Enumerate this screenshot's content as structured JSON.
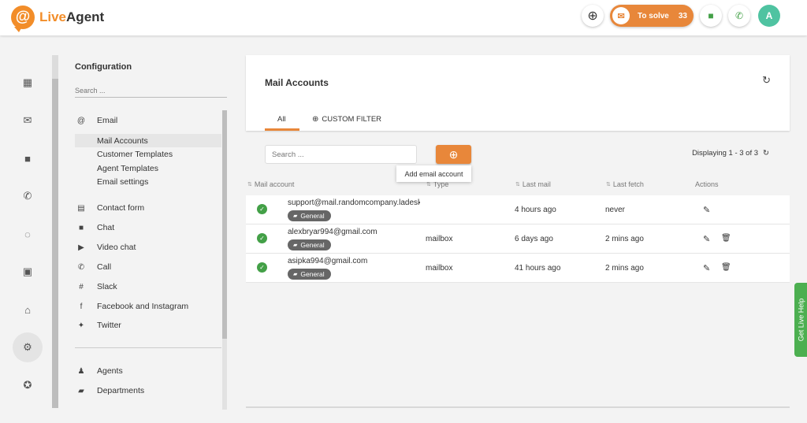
{
  "app": {
    "logo_live": "Live",
    "logo_agent": "Agent",
    "logo_mark": "@"
  },
  "topbar": {
    "solve_label": "To solve",
    "solve_count": "33",
    "avatar_initial": "A",
    "accent_color": "#e8873a"
  },
  "config": {
    "title": "Configuration",
    "search_placeholder": "Search ...",
    "email_group": "Email",
    "email_items": [
      "Mail Accounts",
      "Customer Templates",
      "Agent Templates",
      "Email settings"
    ],
    "channels": [
      "Contact form",
      "Chat",
      "Video chat",
      "Call",
      "Slack",
      "Facebook and Instagram",
      "Twitter"
    ],
    "people": [
      "Agents",
      "Departments"
    ]
  },
  "main": {
    "title": "Mail Accounts",
    "tabs": [
      "All",
      "CUSTOM FILTER"
    ],
    "search_placeholder": "Search ...",
    "add_tooltip": "Add email account",
    "displaying": "Displaying 1 - 3 of 3",
    "columns": [
      "Mail account",
      "Type",
      "Last mail",
      "Last fetch",
      "Actions"
    ],
    "rows": [
      {
        "email": "support@mail.randomcompany.ladesk.com",
        "badge": "General",
        "type": "",
        "last_mail": "4 hours ago",
        "last_fetch": "never"
      },
      {
        "email": "alexbryar994@gmail.com",
        "badge": "General",
        "type": "mailbox",
        "last_mail": "6 days ago",
        "last_fetch": "2 mins ago"
      },
      {
        "email": "asipka994@gmail.com",
        "badge": "General",
        "type": "mailbox",
        "last_mail": "41 hours ago",
        "last_fetch": "2 mins ago"
      }
    ]
  },
  "live_help": "Get Live Help"
}
